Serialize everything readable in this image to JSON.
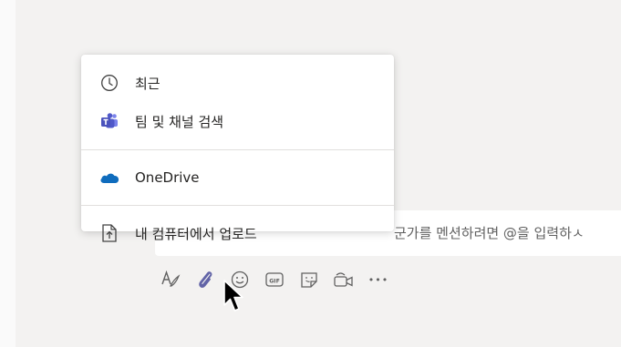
{
  "composer": {
    "placeholder_visible": "군가를 멘션하려면 @을 입력하ㅅ"
  },
  "attach_menu": {
    "items": [
      {
        "label": "최근",
        "icon": "clock-icon"
      },
      {
        "label": "팀 및 채널 검색",
        "icon": "teams-icon"
      },
      {
        "label": "OneDrive",
        "icon": "onedrive-cloud-icon"
      },
      {
        "label": "내 컴퓨터에서 업로드",
        "icon": "upload-file-icon"
      }
    ]
  },
  "toolbar": {
    "buttons": [
      "format-icon",
      "attach-icon",
      "emoji-icon",
      "gif-icon",
      "sticker-icon",
      "meet-now-icon",
      "more-options-icon"
    ],
    "gif_label": "GIF",
    "more_label": "•••"
  },
  "colors": {
    "accent": "#6264a7",
    "onedrive": "#0f6cbd",
    "icon": "#616161"
  }
}
